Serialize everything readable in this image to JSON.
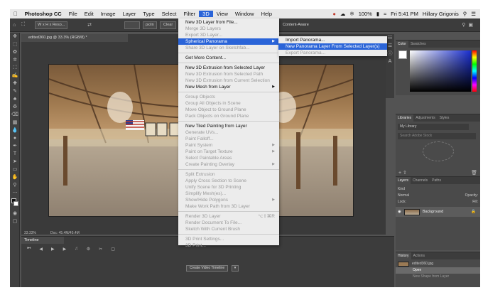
{
  "menubar": {
    "items": [
      "Photoshop CC",
      "File",
      "Edit",
      "Image",
      "Layer",
      "Type",
      "Select",
      "Filter",
      "3D",
      "View",
      "Window",
      "Help"
    ],
    "active_index": 8,
    "battery": "100%",
    "clock": "Fri 5:41 PM",
    "user": "Hillary Grigonis"
  },
  "options": {
    "size_field": "W x H x Reso...",
    "unit": "px/in",
    "clear_label": "Clear",
    "content_aware": "Content-Aware"
  },
  "document": {
    "tab_title": "edited360.jpg @ 33.3% (RGB/8) *",
    "zoom": "33.33%",
    "doc_size": "Doc: 45.4M/45.4M"
  },
  "timeline": {
    "tab_label": "Timeline",
    "create_button": "Create Video Timeline"
  },
  "menu3d": [
    {
      "label": "New 3D Layer from File...",
      "enabled": true
    },
    {
      "label": "Merge 3D Layers",
      "enabled": false
    },
    {
      "label": "Export 3D Layer...",
      "enabled": false
    },
    {
      "label": "Spherical Panorama",
      "enabled": true,
      "submenu": true,
      "highlight": true
    },
    {
      "label": "Share 3D Layer on Sketchfab...",
      "enabled": false
    },
    {
      "sep": true
    },
    {
      "label": "Get More Content...",
      "enabled": true
    },
    {
      "sep": true
    },
    {
      "label": "New 3D Extrusion from Selected Layer",
      "enabled": true
    },
    {
      "label": "New 3D Extrusion from Selected Path",
      "enabled": false
    },
    {
      "label": "New 3D Extrusion from Current Selection",
      "enabled": false
    },
    {
      "label": "New Mesh from Layer",
      "enabled": true,
      "submenu": true
    },
    {
      "sep": true
    },
    {
      "label": "Group Objects",
      "enabled": false
    },
    {
      "label": "Group All Objects in Scene",
      "enabled": false
    },
    {
      "label": "Move Object to Ground Plane",
      "enabled": false
    },
    {
      "label": "Pack Objects on Ground Plane",
      "enabled": false
    },
    {
      "sep": true
    },
    {
      "label": "New Tiled Painting from Layer",
      "enabled": true
    },
    {
      "label": "Generate UVs...",
      "enabled": false
    },
    {
      "label": "Paint Falloff...",
      "enabled": false
    },
    {
      "label": "Paint System",
      "enabled": false,
      "submenu": true
    },
    {
      "label": "Paint on Target Texture",
      "enabled": false,
      "submenu": true
    },
    {
      "label": "Select Paintable Areas",
      "enabled": false
    },
    {
      "label": "Create Painting Overlay",
      "enabled": false,
      "submenu": true
    },
    {
      "sep": true
    },
    {
      "label": "Split Extrusion",
      "enabled": false
    },
    {
      "label": "Apply Cross Section to Scene",
      "enabled": false
    },
    {
      "label": "Unify Scene for 3D Printing",
      "enabled": false
    },
    {
      "label": "Simplify Mesh(es)...",
      "enabled": false
    },
    {
      "label": "Show/Hide Polygons",
      "enabled": false,
      "submenu": true
    },
    {
      "label": "Make Work Path from 3D Layer",
      "enabled": false
    },
    {
      "sep": true
    },
    {
      "label": "Render 3D Layer",
      "enabled": false,
      "shortcut": "⌥⇧⌘R"
    },
    {
      "label": "Render Document To File...",
      "enabled": false
    },
    {
      "label": "Sketch With Current Brush",
      "enabled": false
    },
    {
      "sep": true
    },
    {
      "label": "3D Print Settings...",
      "enabled": false
    },
    {
      "label": "3D Print...",
      "enabled": false
    }
  ],
  "submenu": [
    {
      "label": "Import Panorama...",
      "enabled": true
    },
    {
      "label": "New Panorama Layer From Selected Layer(s)",
      "enabled": true,
      "highlight": true
    },
    {
      "label": "Export Panorama...",
      "enabled": false
    }
  ],
  "panels": {
    "color_tabs": [
      "Color",
      "Swatches"
    ],
    "libraries_tabs": [
      "Libraries",
      "Adjustments",
      "Styles"
    ],
    "library_select": "My Library",
    "library_search": "Search Adobe Stock",
    "layers_tabs": [
      "Layers",
      "Channels",
      "Paths"
    ],
    "layer_kind": "Kind",
    "layer_mode": "Normal",
    "layer_opacity": "Opacity:",
    "layer_lock": "Lock:",
    "layer_fill": "Fill:",
    "layer_name": "Background",
    "history_tabs": [
      "History",
      "Actions"
    ],
    "history_file": "edited360.jpg",
    "history_items": [
      "Open",
      "New Shape from Layer"
    ]
  },
  "colors": {
    "accent": "#2a64d8",
    "color_picker_hue": "#1a2fd0"
  }
}
